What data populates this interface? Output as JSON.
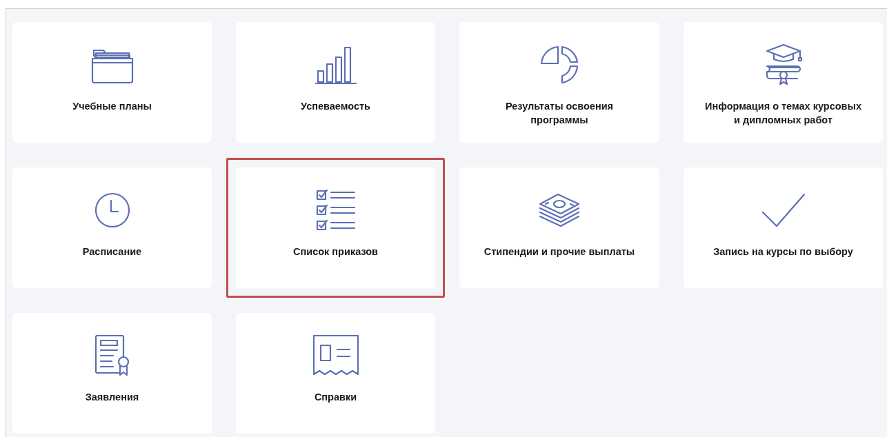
{
  "tiles": [
    {
      "kind": "folder",
      "label": "Учебные планы",
      "highlighted": false
    },
    {
      "kind": "bars",
      "label": "Успеваемость",
      "highlighted": false
    },
    {
      "kind": "pie",
      "label": "Результаты освоения программы",
      "highlighted": false
    },
    {
      "kind": "diploma",
      "label": "Информация о темах курсовых и дипломных работ",
      "highlighted": false
    },
    {
      "kind": "clock",
      "label": "Расписание",
      "highlighted": false
    },
    {
      "kind": "checklist",
      "label": "Список приказов",
      "highlighted": true
    },
    {
      "kind": "money",
      "label": "Стипендии и прочие выплаты",
      "highlighted": false
    },
    {
      "kind": "check",
      "label": "Запись на курсы по выбору",
      "highlighted": false
    },
    {
      "kind": "certificate",
      "label": "Заявления",
      "highlighted": false
    },
    {
      "kind": "receipt",
      "label": "Справки",
      "highlighted": false
    }
  ]
}
